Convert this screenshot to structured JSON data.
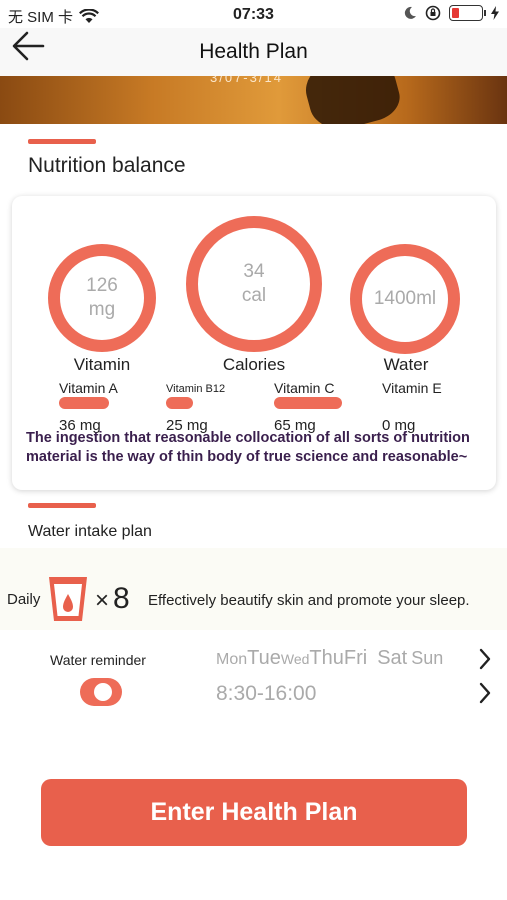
{
  "status_bar": {
    "carrier": "无 SIM 卡",
    "time": "07:33",
    "icons": [
      "wifi-icon",
      "moon-icon",
      "rotation-lock-icon",
      "battery-icon",
      "charging-icon"
    ]
  },
  "nav": {
    "title": "Health Plan",
    "back_icon": "back-arrow-icon"
  },
  "banner": {
    "faded_text": "3/07-3/14"
  },
  "nutrition": {
    "title": "Nutrition balance",
    "rings": [
      {
        "value": "126",
        "unit": "mg",
        "label": "Vitamin"
      },
      {
        "value": "34",
        "unit": "cal",
        "label": "Calories"
      },
      {
        "value": "1400ml",
        "unit": "",
        "label": "Water"
      }
    ],
    "vitamins": [
      {
        "name": "Vitamin A",
        "value": "36 mg"
      },
      {
        "name": "Vitamin B12",
        "value": "25 mg"
      },
      {
        "name": "Vitamin C",
        "value": "65 mg"
      },
      {
        "name": "Vitamin E",
        "value": "0 mg"
      }
    ],
    "note": "The ingestion that reasonable collocation of all sorts of nutrition material is the way of thin body of true science and reasonable~"
  },
  "water_plan": {
    "title": "Water intake plan",
    "daily_label": "Daily",
    "times_symbol": "×",
    "times_count": "8",
    "benefit": "Effectively beautify skin and promote your sleep.",
    "reminder_label": "Water reminder",
    "reminder_on": true,
    "days": [
      "Mon",
      "Tue",
      "Wed",
      "Thu",
      "Fri",
      "Sat",
      "Sun"
    ],
    "time_range": "8:30-16:00"
  },
  "actions": {
    "enter_label": "Enter Health Plan"
  },
  "colors": {
    "accent": "#e8604c",
    "ring": "#ee6c58",
    "muted": "#aaaaaa"
  }
}
